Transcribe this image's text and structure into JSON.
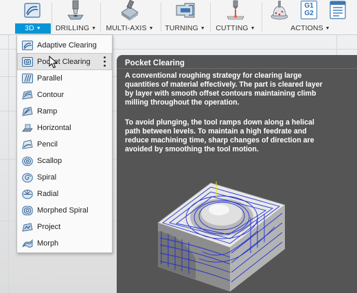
{
  "ribbon": {
    "groups": [
      {
        "label": "3D",
        "active": true
      },
      {
        "label": "DRILLING"
      },
      {
        "label": "MULTI-AXIS"
      },
      {
        "label": "TURNING"
      },
      {
        "label": "CUTTING"
      },
      {
        "label": "ACTIONS"
      }
    ],
    "icons": [
      "3d-adaptive-icon",
      "drill-icon",
      "multi-axis-icon",
      "turning-icon",
      "laser-cut-icon",
      "simulate-icon",
      "post-process-icon",
      "setup-sheet-icon"
    ],
    "gcode_icon_text": [
      "G1",
      "G2"
    ],
    "accent": "#0696d7"
  },
  "menu": {
    "items": [
      {
        "label": "Adaptive Clearing",
        "icon": "adaptive-clearing-icon"
      },
      {
        "label": "Pocket Clearing",
        "icon": "pocket-clearing-icon",
        "hovered": true
      },
      {
        "label": "Parallel",
        "icon": "parallel-icon"
      },
      {
        "label": "Contour",
        "icon": "contour-icon"
      },
      {
        "label": "Ramp",
        "icon": "ramp-icon"
      },
      {
        "label": "Horizontal",
        "icon": "horizontal-icon"
      },
      {
        "label": "Pencil",
        "icon": "pencil-icon"
      },
      {
        "label": "Scallop",
        "icon": "scallop-icon"
      },
      {
        "label": "Spiral",
        "icon": "spiral-icon"
      },
      {
        "label": "Radial",
        "icon": "radial-icon"
      },
      {
        "label": "Morphed Spiral",
        "icon": "morphed-spiral-icon"
      },
      {
        "label": "Project",
        "icon": "project-icon"
      },
      {
        "label": "Morph",
        "icon": "morph-icon"
      }
    ]
  },
  "tooltip": {
    "title": "Pocket Clearing",
    "paragraph1": "A conventional roughing strategy for clearing large quantities of material effectively. The part is cleared layer by layer with smooth offset contours maintaining climb milling throughout the operation.",
    "paragraph2": "To avoid plunging, the tool ramps down along a helical path between levels. To maintain a high feedrate and reduce machining time, sharp changes of direction are avoided by smoothing the tool motion.",
    "background": "#555555",
    "toolpath_color": "#1f2fd0"
  }
}
